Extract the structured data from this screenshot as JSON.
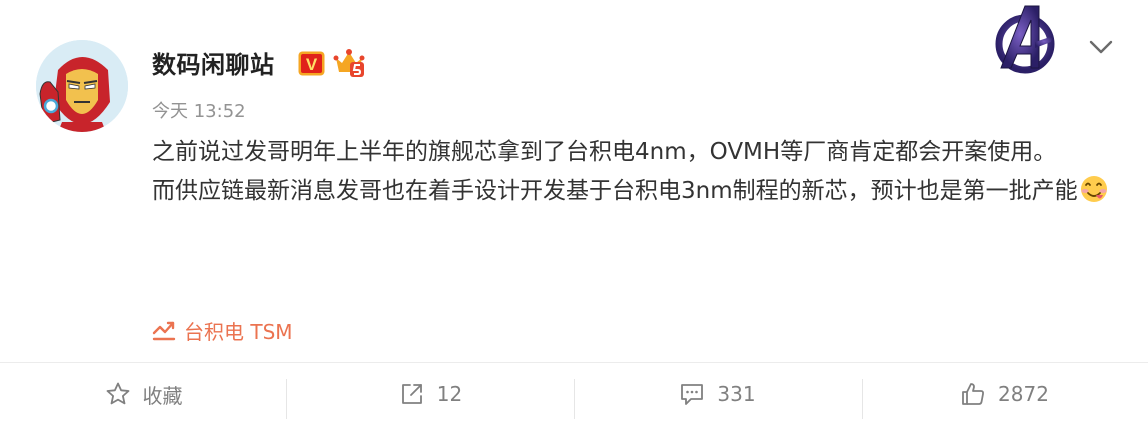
{
  "post": {
    "username": "数码闲聊站",
    "verified_badge": "V",
    "timestamp": "今天 13:52",
    "paragraphs": [
      "之前说过发哥明年上半年的旗舰芯拿到了台积电4nm，OVMH等厂商肯定都会开案使用。",
      "而供应链最新消息发哥也在着手设计开发基于台积电3nm制程的新芯，预计也是第一批产能"
    ],
    "topic_label": "台积电 TSM"
  },
  "actions": {
    "favorite_label": "收藏",
    "share_count": "12",
    "comment_count": "331",
    "like_count": "2872"
  },
  "colors": {
    "accent_orange": "#eb7350",
    "verified_gold": "#f5a623",
    "text_primary": "#333333",
    "text_secondary": "#939393"
  },
  "icons": {
    "menu": "chevron-down-icon",
    "topic": "trend-chart-icon",
    "favorite": "star-icon",
    "share": "share-icon",
    "comment": "comment-icon",
    "like": "thumbs-up-icon"
  }
}
